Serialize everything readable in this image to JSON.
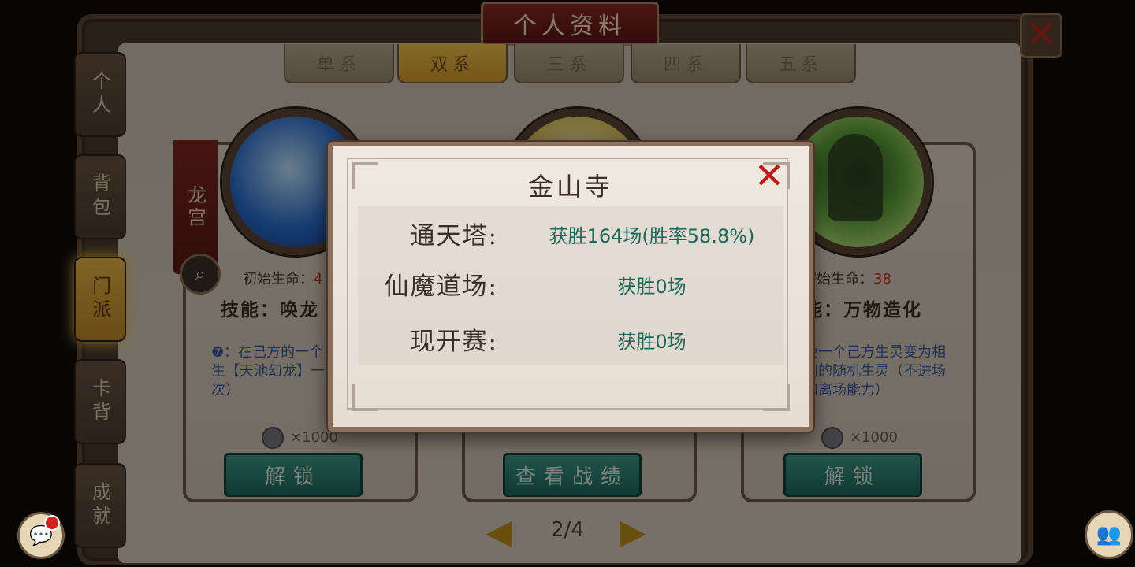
{
  "header": {
    "title": "个人资料"
  },
  "side_tabs": [
    {
      "label": "个人"
    },
    {
      "label": "背包"
    },
    {
      "label": "门派"
    },
    {
      "label": "卡背"
    },
    {
      "label": "成就"
    }
  ],
  "sub_tabs": [
    {
      "label": "单系"
    },
    {
      "label": "双系"
    },
    {
      "label": "三系"
    },
    {
      "label": "四系"
    },
    {
      "label": "五系"
    }
  ],
  "cards": [
    {
      "sect": "龙宫",
      "life_label": "初始生命：",
      "life_value": "4",
      "skill": "技能：唤龙",
      "desc": "❼：在己方的一个生【天池幻龙】一次）",
      "cost": "×1000",
      "button": "解锁"
    },
    {
      "button": "查看战绩"
    },
    {
      "life_label": "初始生命：",
      "life_value": "38",
      "skill": "能：万物造化",
      "desc": "使一个己方生灵变为相同的随机生灵（不进场和离场能力）",
      "cost": "×1000",
      "button": "解锁"
    }
  ],
  "pager": {
    "text": "2/4"
  },
  "modal": {
    "title": "金山寺",
    "stats": [
      {
        "label": "通天塔:",
        "value": "获胜164场(胜率58.8%)"
      },
      {
        "label": "仙魔道场:",
        "value": "获胜0场"
      },
      {
        "label": "现开赛:",
        "value": "获胜0场"
      }
    ]
  },
  "colors": {
    "accent_gold": "#e9b648",
    "win_text": "#1a6a5c",
    "close_red": "#c01c18"
  },
  "icons": [
    "close-icon",
    "search-icon",
    "chat-icon",
    "friends-icon",
    "prev-arrow-icon",
    "next-arrow-icon",
    "coin-icon"
  ]
}
